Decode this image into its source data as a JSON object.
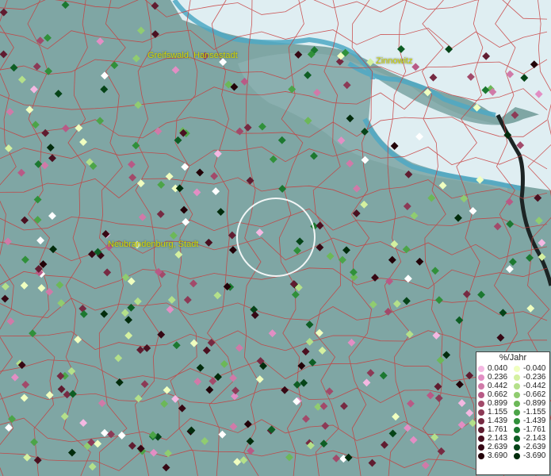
{
  "places": [
    {
      "name": "Greifswald, Hansestadt"
    },
    {
      "name": "Zinnowitz"
    },
    {
      "name": "Neubrandenburg, Stadt"
    }
  ],
  "legend": {
    "title": "%/Jahr",
    "positive": [
      "0.040",
      "0.236",
      "0.442",
      "0.662",
      "0.899",
      "1.155",
      "1.439",
      "1.761",
      "2.143",
      "2.639",
      "3.690"
    ],
    "negative": [
      "-0.040",
      "-0.236",
      "-0.442",
      "-0.662",
      "-0.899",
      "-1.155",
      "-1.439",
      "-1.761",
      "-2.143",
      "-2.639",
      "-3.690"
    ],
    "positive_colors": [
      "#f4b8e2",
      "#e28ec4",
      "#d07aa8",
      "#b85a86",
      "#a24a6a",
      "#8c3a56",
      "#762a42",
      "#601c30",
      "#4a1020",
      "#360814",
      "#220208"
    ],
    "negative_colors": [
      "#f0ffc0",
      "#d4f0a0",
      "#b4e08a",
      "#90cc70",
      "#6cb858",
      "#4ca448",
      "#30903a",
      "#1c7830",
      "#0e5e24",
      "#064418",
      "#022c0c"
    ]
  },
  "colors": {
    "land": "#7fa6a4",
    "sea": "#dfeef2",
    "coast": "#4ea8c4",
    "borders": "#c83c3c",
    "white_point": "#ffffff"
  }
}
